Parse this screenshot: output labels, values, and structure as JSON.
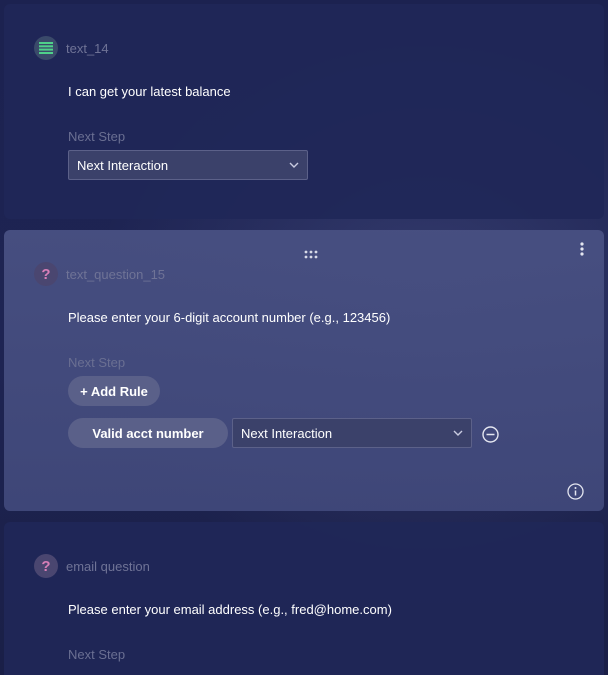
{
  "cards": [
    {
      "title": "text_14",
      "icon": "text-lines-icon",
      "message": "I can get your latest balance",
      "next_step_label": "Next Step",
      "next_step_value": "Next Interaction"
    },
    {
      "title": "text_question_15",
      "icon": "question-mark-icon",
      "message": "Please enter your 6-digit account number (e.g., 123456)",
      "next_step_label": "Next Step",
      "add_rule_label": "+ Add Rule",
      "rule": {
        "name": "Valid acct number",
        "target": "Next Interaction"
      }
    },
    {
      "title": "email question",
      "icon": "question-mark-icon",
      "message": "Please enter your email address (e.g., fred@home.com)",
      "next_step_label": "Next Step"
    }
  ],
  "colors": {
    "background": "#1a1f47",
    "card": "#202758",
    "card_active": "#48507e",
    "text_icon": "#4fd08a",
    "question_icon": "#d77fb8"
  }
}
